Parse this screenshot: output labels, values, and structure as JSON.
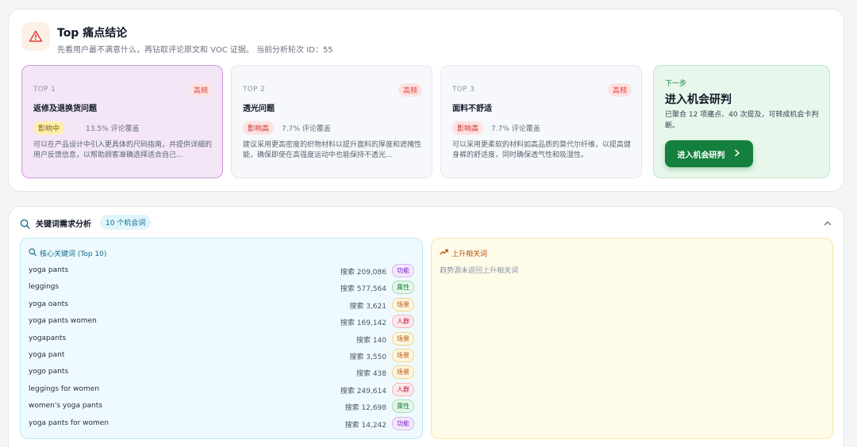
{
  "header": {
    "title": "Top 痛点结论",
    "subtitle": "先看用户最不满意什么，再钻取评论原文和 VOC 证据。 当前分析轮次 ID：55"
  },
  "pain_points": [
    {
      "rank": "TOP 1",
      "freq": "高频",
      "title": "返修及退换货问题",
      "impact": "影响中",
      "coverage": "13.5% 评论覆盖",
      "desc": "可以在产品设计中引入更具体的尺码指南，并提供详细的用户反馈信息，以帮助顾客准确选择适合自己..."
    },
    {
      "rank": "TOP 2",
      "freq": "高频",
      "title": "透光问题",
      "impact": "影响高",
      "coverage": "7.7% 评论覆盖",
      "desc": "建议采用更高密度的织物材料以提升面料的厚度和遮掩性能，确保即使在高强度运动中也能保持不透光..."
    },
    {
      "rank": "TOP 3",
      "freq": "高频",
      "title": "面料不舒适",
      "impact": "影响高",
      "coverage": "7.7% 评论覆盖",
      "desc": "可以采用更柔软的材料如高品质的莫代尔纤维，以提高健身裤的舒适度，同时确保透气性和吸湿性。"
    }
  ],
  "next_step": {
    "label": "下一步",
    "title": "进入机会研判",
    "desc": "已聚合 12 项痛点、40 次提及，可转成机会卡判断。",
    "button": "进入机会研判"
  },
  "keywords": {
    "title": "关键词需求分析",
    "count_badge": "10 个机会词",
    "core_title": "核心关键词 (Top 10)",
    "rows": [
      {
        "name": "yoga pants",
        "search": "搜索 209,086",
        "tag": "功能"
      },
      {
        "name": "leggings",
        "search": "搜索 577,564",
        "tag": "属性"
      },
      {
        "name": "yoga oants",
        "search": "搜索 3,621",
        "tag": "场景"
      },
      {
        "name": "yoga pants women",
        "search": "搜索 169,142",
        "tag": "人群"
      },
      {
        "name": "yogapants",
        "search": "搜索 140",
        "tag": "场景"
      },
      {
        "name": "yoga pant",
        "search": "搜索 3,550",
        "tag": "场景"
      },
      {
        "name": "yogo pants",
        "search": "搜索 438",
        "tag": "场景"
      },
      {
        "name": "leggings for women",
        "search": "搜索 249,614",
        "tag": "人群"
      },
      {
        "name": "women's yoga pants",
        "search": "搜索 12,698",
        "tag": "属性"
      },
      {
        "name": "yoga pants for women",
        "search": "搜索 14,242",
        "tag": "功能"
      }
    ],
    "rising_title": "上升相关词",
    "rising_empty": "趋势源未返回上升相关词"
  }
}
